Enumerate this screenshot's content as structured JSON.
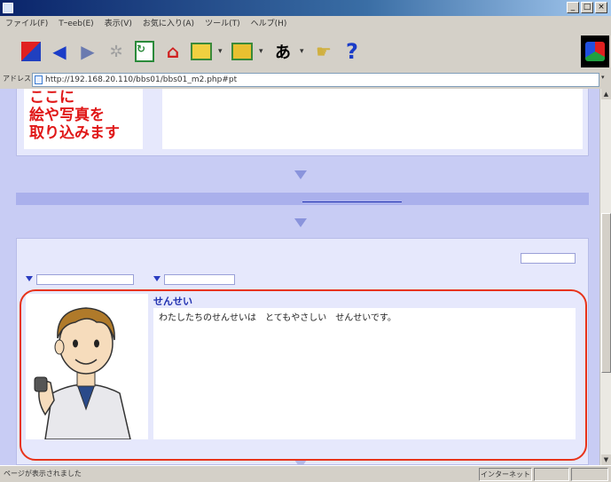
{
  "window": {
    "title": "",
    "buttons": [
      "_",
      "□",
      "×"
    ]
  },
  "menubar": {
    "items": [
      "ファイル(F)",
      "Tｰeeb(E)",
      "表示(V)",
      "お気に入り(A)",
      "ツール(T)",
      "ヘルプ(H)"
    ]
  },
  "toolbar": {
    "font_glyph": "あ",
    "help_glyph": "?"
  },
  "address": {
    "label": "アドレス",
    "url": "http://192.168.20.110/bbs01/bbs01_m2.php#pt"
  },
  "top_post": {
    "image_text_lines": [
      "ここに",
      "絵や写真を",
      "取り込みます"
    ]
  },
  "bottom_post": {
    "title": "せんせい",
    "body": "わたしたちのせんせいは　とてもやさしい　せんせいです。"
  },
  "statusbar": {
    "text": "ページが表示されました",
    "zone": "インターネット"
  },
  "colors": {
    "highlight": "#e8331a",
    "red_text": "#e01818",
    "panel_bg": "#c8ccf4"
  }
}
